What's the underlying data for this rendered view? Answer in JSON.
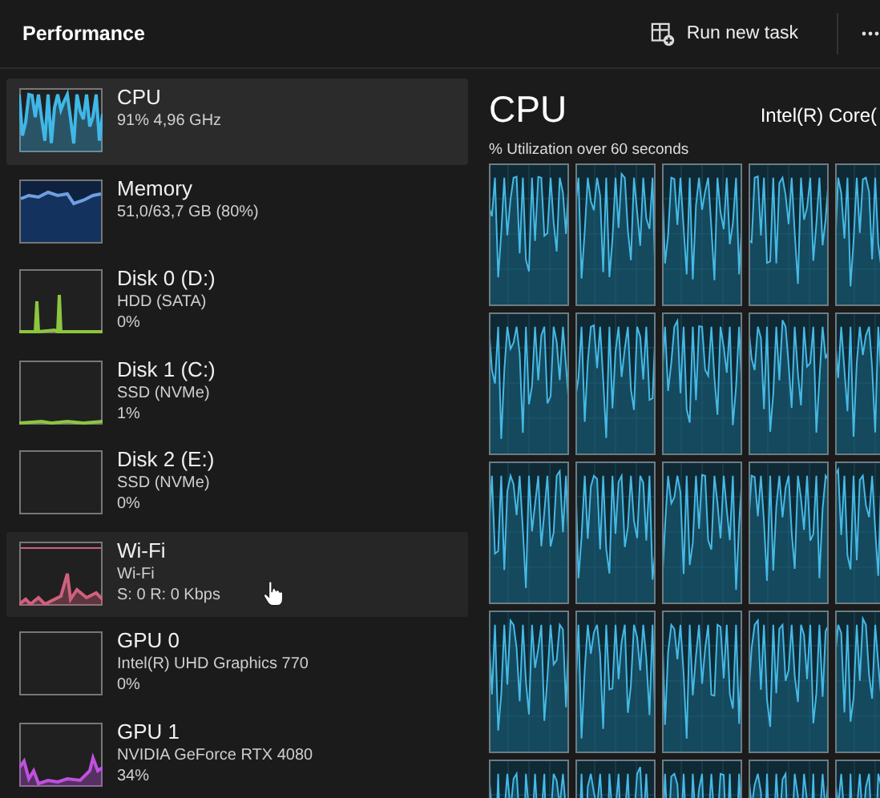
{
  "header": {
    "title": "Performance",
    "run_task_button": "Run new task"
  },
  "sidebar": {
    "items": [
      {
        "kind": "cpu",
        "name": "CPU",
        "lines": [
          "91%  4,96 GHz"
        ],
        "color": "#3fb8e8",
        "selected": true,
        "hovered": false
      },
      {
        "kind": "memory",
        "name": "Memory",
        "lines": [
          "51,0/63,7 GB (80%)"
        ],
        "color": "#14325e",
        "selected": false,
        "hovered": false
      },
      {
        "kind": "disk",
        "name": "Disk 0 (D:)",
        "lines": [
          "HDD (SATA)",
          "0%"
        ],
        "color": "#8cc63f",
        "selected": false,
        "hovered": false
      },
      {
        "kind": "idle",
        "name": "Disk 1 (C:)",
        "lines": [
          "SSD (NVMe)",
          "1%"
        ],
        "color": "#8cc63f",
        "selected": false,
        "hovered": false
      },
      {
        "kind": "empty",
        "name": "Disk 2 (E:)",
        "lines": [
          "SSD (NVMe)",
          "0%"
        ],
        "selected": false,
        "hovered": false
      },
      {
        "kind": "network",
        "name": "Wi-Fi",
        "lines": [
          "Wi-Fi",
          "S: 0 R: 0 Kbps"
        ],
        "color": "#d0607e",
        "selected": false,
        "hovered": true
      },
      {
        "kind": "empty",
        "name": "GPU 0",
        "lines": [
          "Intel(R) UHD Graphics 770",
          "0%"
        ],
        "selected": false,
        "hovered": false
      },
      {
        "kind": "gpu",
        "name": "GPU 1",
        "lines": [
          "NVIDIA GeForce RTX 4080",
          "34%"
        ],
        "color": "#c050e0",
        "selected": false,
        "hovered": false
      }
    ]
  },
  "detail": {
    "title": "CPU",
    "model": "Intel(R) Core(",
    "graph_caption": "% Utilization over 60 seconds"
  }
}
